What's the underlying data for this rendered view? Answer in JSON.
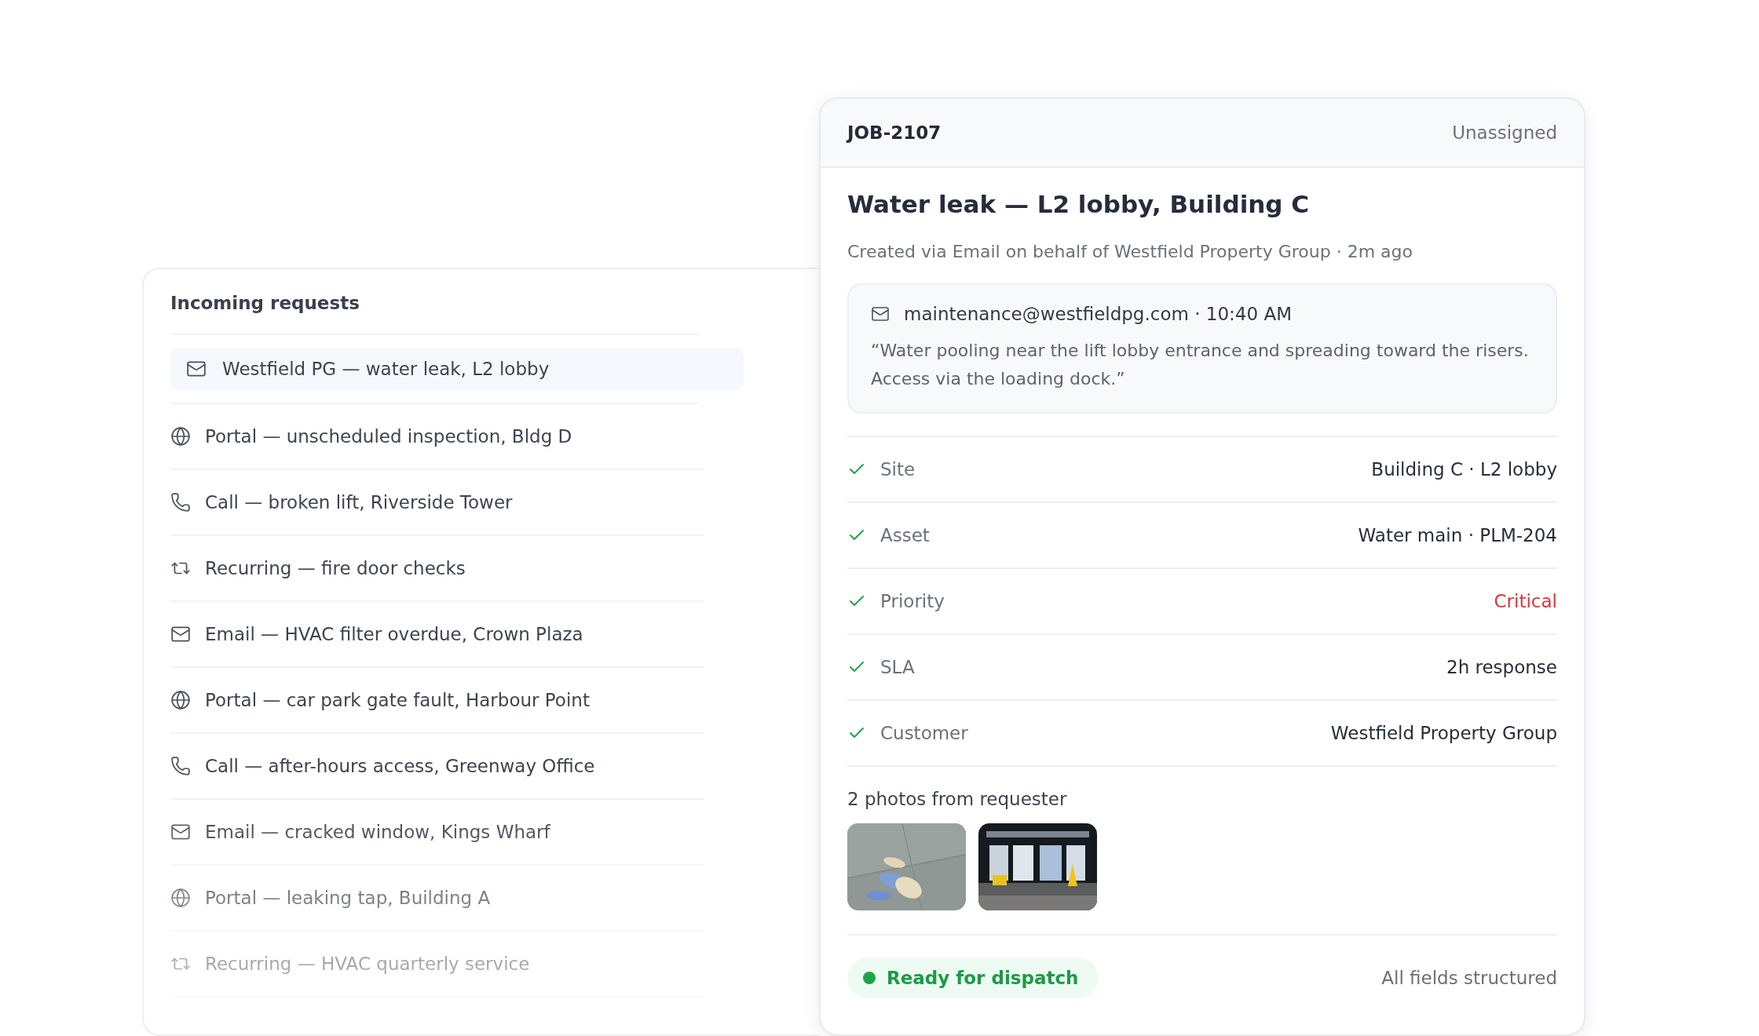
{
  "requests": {
    "title": "Incoming requests",
    "items": [
      {
        "kind": "email",
        "text": "Westfield PG — water leak, L2 lobby",
        "selected": true
      },
      {
        "kind": "portal",
        "text": "Portal — unscheduled inspection, Bldg D",
        "selected": false
      },
      {
        "kind": "call",
        "text": "Call — broken lift, Riverside Tower",
        "selected": false
      },
      {
        "kind": "recurring",
        "text": "Recurring — fire door checks",
        "selected": false
      },
      {
        "kind": "email",
        "text": "Email — HVAC filter overdue, Crown Plaza",
        "selected": false
      },
      {
        "kind": "portal",
        "text": "Portal — car park gate fault, Harbour Point",
        "selected": false
      },
      {
        "kind": "call",
        "text": "Call — after-hours access, Greenway Office",
        "selected": false
      },
      {
        "kind": "email",
        "text": "Email — cracked window, Kings Wharf",
        "selected": false
      },
      {
        "kind": "portal",
        "text": "Portal — leaking tap, Building A",
        "selected": false
      },
      {
        "kind": "recurring",
        "text": "Recurring — HVAC quarterly service",
        "selected": false
      }
    ]
  },
  "job": {
    "id": "JOB-2107",
    "assignee": "Unassigned",
    "title": "Water leak — L2 lobby, Building C",
    "meta": "Created via Email on behalf of Westfield Property Group · 2m ago",
    "message": {
      "from": "maintenance@westfieldpg.com · 10:40 AM",
      "body": "“Water pooling near the lift lobby entrance and spreading toward the risers. Access via the loading dock.”"
    },
    "fields": [
      {
        "label": "Site",
        "value": "Building C · L2 lobby",
        "checked": true,
        "kind": "normal"
      },
      {
        "label": "Asset",
        "value": "Water main · PLM-204",
        "checked": true,
        "kind": "normal"
      },
      {
        "label": "Priority",
        "value": "Critical",
        "checked": true,
        "kind": "critical"
      },
      {
        "label": "SLA",
        "value": "2h response",
        "checked": true,
        "kind": "normal"
      },
      {
        "label": "Customer",
        "value": "Westfield Property Group",
        "checked": true,
        "kind": "normal"
      }
    ],
    "photos": {
      "caption": "2 photos from requester",
      "items": [
        {
          "kind": "floor"
        },
        {
          "kind": "entrance"
        }
      ]
    },
    "status": {
      "label": "Ready for dispatch",
      "note": "All fields structured"
    }
  }
}
